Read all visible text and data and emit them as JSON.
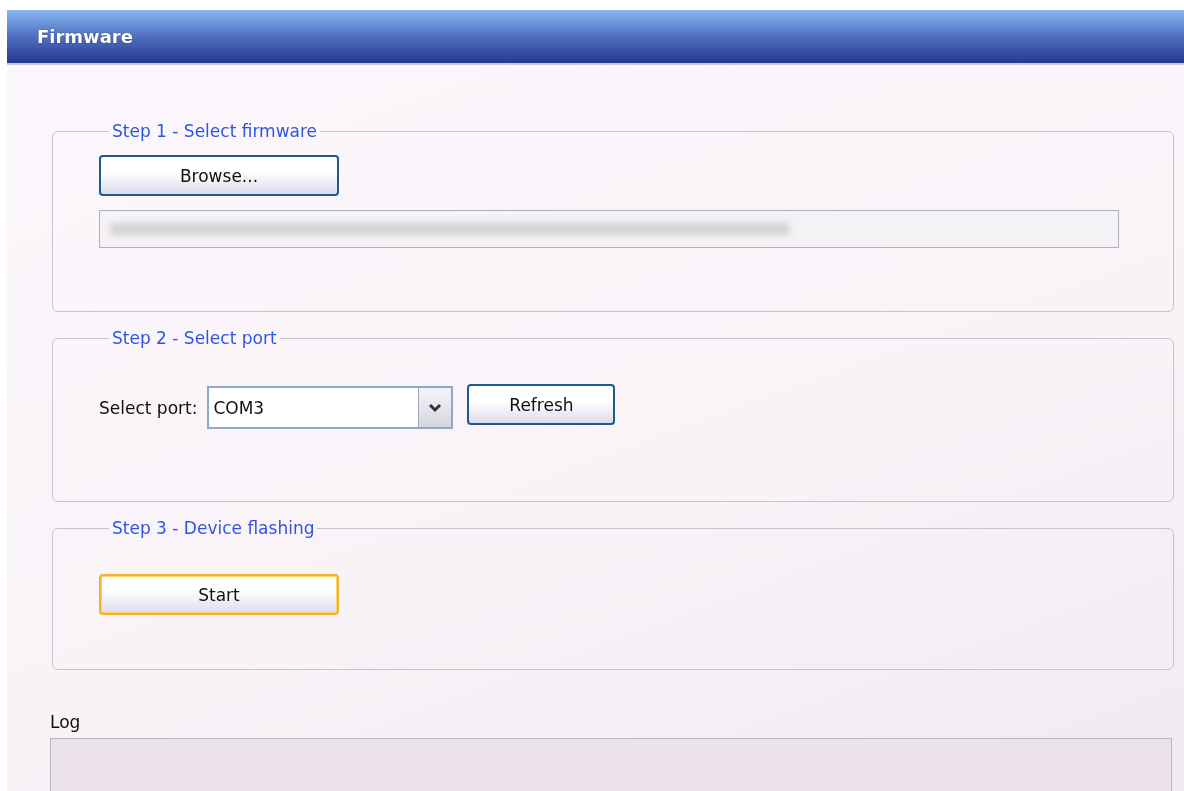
{
  "window": {
    "title": "Firmware"
  },
  "steps": [
    {
      "kind": "file",
      "legend": "Step 1 - Select firmware",
      "button": {
        "label": "Browse...",
        "focused": false
      },
      "path_field": {
        "disabled": true
      }
    },
    {
      "kind": "port",
      "legend": "Step 2 - Select port",
      "field_label": "Select port:",
      "dropdown": {
        "value": "COM3"
      },
      "button": {
        "label": "Refresh",
        "focused": false
      }
    },
    {
      "kind": "action",
      "legend": "Step 3 - Device flashing",
      "button": {
        "label": "Start",
        "focused": true
      }
    }
  ],
  "log": {
    "label": "Log"
  }
}
